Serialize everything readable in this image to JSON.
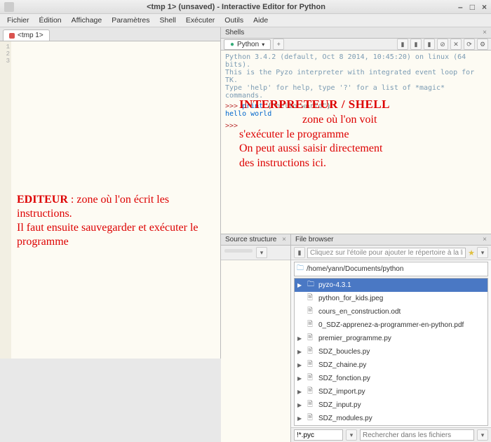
{
  "window": {
    "title": "<tmp 1> (unsaved) - Interactive Editor for Python"
  },
  "menu": {
    "items": [
      "Fichier",
      "Édition",
      "Affichage",
      "Paramètres",
      "Shell",
      "Exécuter",
      "Outils",
      "Aide"
    ]
  },
  "editor": {
    "tab_label": "<tmp 1>",
    "line_numbers": [
      "1",
      "2",
      "3"
    ],
    "annotation_title": "EDITEUR",
    "annotation_body1": " : zone où l'on écrit les instructions.",
    "annotation_body2": "Il faut ensuite sauvegarder et exécuter le programme"
  },
  "shell": {
    "panel_title": "Shells",
    "tab_label": "Python",
    "info1": "Python 3.4.2 (default, Oct  8 2014, 10:45:20) on linux (64 bits).",
    "info2": "This is the Pyzo interpreter with integrated event loop for TK.",
    "info3": "Type 'help' for help, type '?' for a list of *magic* commands.",
    "prompt1": ">>>",
    "code_kw": "print",
    "code_paren_open": " (",
    "code_str": "\"hello world\"",
    "code_paren_close": ")",
    "output": "hello world",
    "prompt2": ">>>",
    "annotation_title": "INTERPRETEUR  / SHELL",
    "annotation_l1": "zone où l'on voit",
    "annotation_l2": "s'exécuter le programme",
    "annotation_l3": "On peut aussi saisir directement",
    "annotation_l4": "des instructions ici."
  },
  "source_structure": {
    "panel_title": "Source structure"
  },
  "file_browser": {
    "panel_title": "File browser",
    "hint": "Cliquez sur l'étoile pour ajouter le répertoire à la liste des projets",
    "path": "/home/yann/Documents/python",
    "selected": "pyzo-4.3.1",
    "files": [
      "python_for_kids.jpeg",
      "cours_en_construction.odt",
      "0_SDZ-apprenez-a-programmer-en-python.pdf",
      "premier_programme.py",
      "SDZ_boucles.py",
      "SDZ_chaine.py",
      "SDZ_fonction.py",
      "SDZ_import.py",
      "SDZ_input.py",
      "SDZ_modules.py"
    ],
    "filter": "!*.pyc",
    "search_placeholder": "Rechercher dans les fichiers"
  }
}
